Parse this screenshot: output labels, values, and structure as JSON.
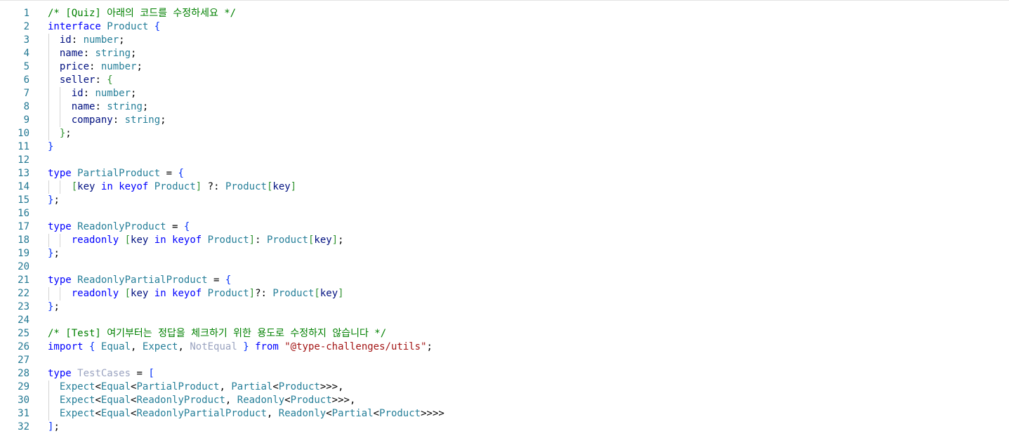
{
  "editor": {
    "language": "typescript",
    "lines": [
      {
        "n": "1",
        "indent": 0,
        "tokens": [
          {
            "t": "/* [Quiz] 아래의 코드를 수정하세요 */",
            "c": "comment"
          }
        ]
      },
      {
        "n": "2",
        "indent": 0,
        "tokens": [
          {
            "t": "interface",
            "c": "keyword"
          },
          {
            "t": " "
          },
          {
            "t": "Product",
            "c": "type"
          },
          {
            "t": " "
          },
          {
            "t": "{",
            "c": "brace1"
          }
        ]
      },
      {
        "n": "3",
        "indent": 1,
        "tokens": [
          {
            "t": "  "
          },
          {
            "t": "id",
            "c": "prop"
          },
          {
            "t": ": ",
            "c": "punc"
          },
          {
            "t": "number",
            "c": "type"
          },
          {
            "t": ";",
            "c": "punc"
          }
        ]
      },
      {
        "n": "4",
        "indent": 1,
        "tokens": [
          {
            "t": "  "
          },
          {
            "t": "name",
            "c": "prop"
          },
          {
            "t": ": ",
            "c": "punc"
          },
          {
            "t": "string",
            "c": "type"
          },
          {
            "t": ";",
            "c": "punc"
          }
        ]
      },
      {
        "n": "5",
        "indent": 1,
        "tokens": [
          {
            "t": "  "
          },
          {
            "t": "price",
            "c": "prop"
          },
          {
            "t": ": ",
            "c": "punc"
          },
          {
            "t": "number",
            "c": "type"
          },
          {
            "t": ";",
            "c": "punc"
          }
        ]
      },
      {
        "n": "6",
        "indent": 1,
        "tokens": [
          {
            "t": "  "
          },
          {
            "t": "seller",
            "c": "prop"
          },
          {
            "t": ": ",
            "c": "punc"
          },
          {
            "t": "{",
            "c": "brace2"
          }
        ]
      },
      {
        "n": "7",
        "indent": 2,
        "tokens": [
          {
            "t": "    "
          },
          {
            "t": "id",
            "c": "prop"
          },
          {
            "t": ": ",
            "c": "punc"
          },
          {
            "t": "number",
            "c": "type"
          },
          {
            "t": ";",
            "c": "punc"
          }
        ]
      },
      {
        "n": "8",
        "indent": 2,
        "tokens": [
          {
            "t": "    "
          },
          {
            "t": "name",
            "c": "prop"
          },
          {
            "t": ": ",
            "c": "punc"
          },
          {
            "t": "string",
            "c": "type"
          },
          {
            "t": ";",
            "c": "punc"
          }
        ]
      },
      {
        "n": "9",
        "indent": 2,
        "tokens": [
          {
            "t": "    "
          },
          {
            "t": "company",
            "c": "prop"
          },
          {
            "t": ": ",
            "c": "punc"
          },
          {
            "t": "string",
            "c": "type"
          },
          {
            "t": ";",
            "c": "punc"
          }
        ]
      },
      {
        "n": "10",
        "indent": 1,
        "tokens": [
          {
            "t": "  "
          },
          {
            "t": "}",
            "c": "brace2"
          },
          {
            "t": ";",
            "c": "punc"
          }
        ]
      },
      {
        "n": "11",
        "indent": 0,
        "tokens": [
          {
            "t": "}",
            "c": "brace1"
          }
        ]
      },
      {
        "n": "12",
        "indent": 0,
        "tokens": []
      },
      {
        "n": "13",
        "indent": 0,
        "tokens": [
          {
            "t": "type",
            "c": "keyword"
          },
          {
            "t": " "
          },
          {
            "t": "PartialProduct",
            "c": "type"
          },
          {
            "t": " = ",
            "c": "punc"
          },
          {
            "t": "{",
            "c": "brace1"
          }
        ]
      },
      {
        "n": "14",
        "indent": 2,
        "tokens": [
          {
            "t": "    "
          },
          {
            "t": "[",
            "c": "brace2"
          },
          {
            "t": "key",
            "c": "prop"
          },
          {
            "t": " "
          },
          {
            "t": "in",
            "c": "keyword"
          },
          {
            "t": " "
          },
          {
            "t": "keyof",
            "c": "keyword"
          },
          {
            "t": " "
          },
          {
            "t": "Product",
            "c": "type"
          },
          {
            "t": "]",
            "c": "brace2"
          },
          {
            "t": " ?: ",
            "c": "punc"
          },
          {
            "t": "Product",
            "c": "type"
          },
          {
            "t": "[",
            "c": "brace2"
          },
          {
            "t": "key",
            "c": "prop"
          },
          {
            "t": "]",
            "c": "brace2"
          }
        ]
      },
      {
        "n": "15",
        "indent": 0,
        "tokens": [
          {
            "t": "}",
            "c": "brace1"
          },
          {
            "t": ";",
            "c": "punc"
          }
        ]
      },
      {
        "n": "16",
        "indent": 0,
        "tokens": []
      },
      {
        "n": "17",
        "indent": 0,
        "tokens": [
          {
            "t": "type",
            "c": "keyword"
          },
          {
            "t": " "
          },
          {
            "t": "ReadonlyProduct",
            "c": "type"
          },
          {
            "t": " = ",
            "c": "punc"
          },
          {
            "t": "{",
            "c": "brace1"
          }
        ]
      },
      {
        "n": "18",
        "indent": 2,
        "tokens": [
          {
            "t": "    "
          },
          {
            "t": "readonly",
            "c": "keyword"
          },
          {
            "t": " "
          },
          {
            "t": "[",
            "c": "brace2"
          },
          {
            "t": "key",
            "c": "prop"
          },
          {
            "t": " "
          },
          {
            "t": "in",
            "c": "keyword"
          },
          {
            "t": " "
          },
          {
            "t": "keyof",
            "c": "keyword"
          },
          {
            "t": " "
          },
          {
            "t": "Product",
            "c": "type"
          },
          {
            "t": "]",
            "c": "brace2"
          },
          {
            "t": ": ",
            "c": "punc"
          },
          {
            "t": "Product",
            "c": "type"
          },
          {
            "t": "[",
            "c": "brace2"
          },
          {
            "t": "key",
            "c": "prop"
          },
          {
            "t": "]",
            "c": "brace2"
          },
          {
            "t": ";",
            "c": "punc"
          }
        ]
      },
      {
        "n": "19",
        "indent": 0,
        "tokens": [
          {
            "t": "}",
            "c": "brace1"
          },
          {
            "t": ";",
            "c": "punc"
          }
        ]
      },
      {
        "n": "20",
        "indent": 0,
        "tokens": []
      },
      {
        "n": "21",
        "indent": 0,
        "tokens": [
          {
            "t": "type",
            "c": "keyword"
          },
          {
            "t": " "
          },
          {
            "t": "ReadonlyPartialProduct",
            "c": "type"
          },
          {
            "t": " = ",
            "c": "punc"
          },
          {
            "t": "{",
            "c": "brace1"
          }
        ]
      },
      {
        "n": "22",
        "indent": 2,
        "tokens": [
          {
            "t": "    "
          },
          {
            "t": "readonly",
            "c": "keyword"
          },
          {
            "t": " "
          },
          {
            "t": "[",
            "c": "brace2"
          },
          {
            "t": "key",
            "c": "prop"
          },
          {
            "t": " "
          },
          {
            "t": "in",
            "c": "keyword"
          },
          {
            "t": " "
          },
          {
            "t": "keyof",
            "c": "keyword"
          },
          {
            "t": " "
          },
          {
            "t": "Product",
            "c": "type"
          },
          {
            "t": "]",
            "c": "brace2"
          },
          {
            "t": "?: ",
            "c": "punc"
          },
          {
            "t": "Product",
            "c": "type"
          },
          {
            "t": "[",
            "c": "brace2"
          },
          {
            "t": "key",
            "c": "prop"
          },
          {
            "t": "]",
            "c": "brace2"
          }
        ]
      },
      {
        "n": "23",
        "indent": 0,
        "tokens": [
          {
            "t": "}",
            "c": "brace1"
          },
          {
            "t": ";",
            "c": "punc"
          }
        ]
      },
      {
        "n": "24",
        "indent": 0,
        "tokens": []
      },
      {
        "n": "25",
        "indent": 0,
        "tokens": [
          {
            "t": "/* [Test] 여기부터는 정답을 체크하기 위한 용도로 수정하지 않습니다 */",
            "c": "comment"
          }
        ]
      },
      {
        "n": "26",
        "indent": 0,
        "tokens": [
          {
            "t": "import",
            "c": "keyword"
          },
          {
            "t": " "
          },
          {
            "t": "{",
            "c": "brace1"
          },
          {
            "t": " "
          },
          {
            "t": "Equal",
            "c": "type"
          },
          {
            "t": ", ",
            "c": "punc"
          },
          {
            "t": "Expect",
            "c": "type"
          },
          {
            "t": ", ",
            "c": "punc"
          },
          {
            "t": "NotEqual",
            "c": "dim"
          },
          {
            "t": " "
          },
          {
            "t": "}",
            "c": "brace1"
          },
          {
            "t": " "
          },
          {
            "t": "from",
            "c": "keyword"
          },
          {
            "t": " "
          },
          {
            "t": "\"@type-challenges/utils\"",
            "c": "string"
          },
          {
            "t": ";",
            "c": "punc"
          }
        ]
      },
      {
        "n": "27",
        "indent": 0,
        "tokens": []
      },
      {
        "n": "28",
        "indent": 0,
        "tokens": [
          {
            "t": "type",
            "c": "keyword"
          },
          {
            "t": " "
          },
          {
            "t": "TestCases",
            "c": "dim"
          },
          {
            "t": " = ",
            "c": "punc"
          },
          {
            "t": "[",
            "c": "brace1"
          }
        ]
      },
      {
        "n": "29",
        "indent": 1,
        "tokens": [
          {
            "t": "  "
          },
          {
            "t": "Expect",
            "c": "type"
          },
          {
            "t": "<",
            "c": "punc"
          },
          {
            "t": "Equal",
            "c": "type"
          },
          {
            "t": "<",
            "c": "punc"
          },
          {
            "t": "PartialProduct",
            "c": "type"
          },
          {
            "t": ", ",
            "c": "punc"
          },
          {
            "t": "Partial",
            "c": "type"
          },
          {
            "t": "<",
            "c": "punc"
          },
          {
            "t": "Product",
            "c": "type"
          },
          {
            "t": ">>>",
            "c": "punc"
          },
          {
            "t": ",",
            "c": "punc"
          }
        ]
      },
      {
        "n": "30",
        "indent": 1,
        "tokens": [
          {
            "t": "  "
          },
          {
            "t": "Expect",
            "c": "type"
          },
          {
            "t": "<",
            "c": "punc"
          },
          {
            "t": "Equal",
            "c": "type"
          },
          {
            "t": "<",
            "c": "punc"
          },
          {
            "t": "ReadonlyProduct",
            "c": "type"
          },
          {
            "t": ", ",
            "c": "punc"
          },
          {
            "t": "Readonly",
            "c": "type"
          },
          {
            "t": "<",
            "c": "punc"
          },
          {
            "t": "Product",
            "c": "type"
          },
          {
            "t": ">>>",
            "c": "punc"
          },
          {
            "t": ",",
            "c": "punc"
          }
        ]
      },
      {
        "n": "31",
        "indent": 1,
        "tokens": [
          {
            "t": "  "
          },
          {
            "t": "Expect",
            "c": "type"
          },
          {
            "t": "<",
            "c": "punc"
          },
          {
            "t": "Equal",
            "c": "type"
          },
          {
            "t": "<",
            "c": "punc"
          },
          {
            "t": "ReadonlyPartialProduct",
            "c": "type"
          },
          {
            "t": ", ",
            "c": "punc"
          },
          {
            "t": "Readonly",
            "c": "type"
          },
          {
            "t": "<",
            "c": "punc"
          },
          {
            "t": "Partial",
            "c": "type"
          },
          {
            "t": "<",
            "c": "punc"
          },
          {
            "t": "Product",
            "c": "type"
          },
          {
            "t": ">>>>",
            "c": "punc"
          }
        ]
      },
      {
        "n": "32",
        "indent": 0,
        "tokens": [
          {
            "t": "]",
            "c": "brace1"
          },
          {
            "t": ";",
            "c": "punc"
          }
        ]
      }
    ]
  }
}
